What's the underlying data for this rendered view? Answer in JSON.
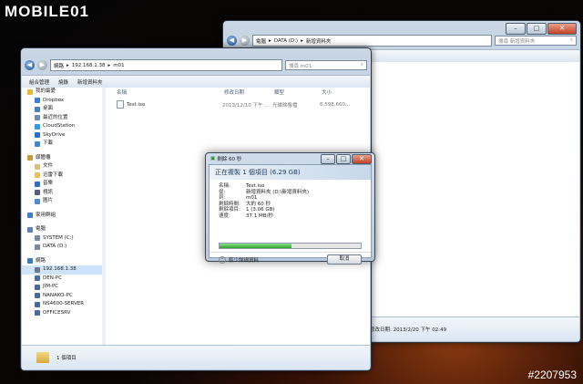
{
  "watermark": {
    "logo": "MOBILE01",
    "id": "#2207953"
  },
  "back_window": {
    "breadcrumb": [
      "電腦",
      "DATA (D:)",
      "新增資料夾"
    ],
    "search_placeholder": "搜尋 新增資料夾",
    "status_date": "修改日期: 2013/2/20 下午 02:49"
  },
  "front_window": {
    "breadcrumb": [
      "網路",
      "192.168.1.38",
      "m01"
    ],
    "search_placeholder": "搜尋 m01",
    "toolbar": [
      "組合管理",
      "燒錄",
      "新增資料夾"
    ],
    "nav_groups": [
      {
        "items": [
          {
            "label": "我的最愛",
            "icon": "star-icon",
            "color": "#e8b830"
          },
          {
            "label": "Dropbox",
            "icon": "dropbox-icon",
            "color": "#3b80d6"
          },
          {
            "label": "桌面",
            "icon": "desktop-icon",
            "color": "#4a7fc1"
          },
          {
            "label": "最近的位置",
            "icon": "recent-icon",
            "color": "#6b8db4"
          },
          {
            "label": "CloudStation",
            "icon": "cloud-icon",
            "color": "#2f9be0"
          },
          {
            "label": "SkyDrive",
            "icon": "skydrive-icon",
            "color": "#2a6fd1"
          },
          {
            "label": "下載",
            "icon": "download-icon",
            "color": "#3f86cf"
          }
        ]
      },
      {
        "items": [
          {
            "label": "媒體櫃",
            "icon": "library-icon",
            "color": "#c99a3a"
          },
          {
            "label": "文件",
            "icon": "documents-icon",
            "color": "#d9c07a"
          },
          {
            "label": "迅雷下載",
            "icon": "folder-icon",
            "color": "#e6c05a"
          },
          {
            "label": "音樂",
            "icon": "music-icon",
            "color": "#2f6fc4"
          },
          {
            "label": "視訊",
            "icon": "video-icon",
            "color": "#5a5a7a"
          },
          {
            "label": "圖片",
            "icon": "pictures-icon",
            "color": "#4b8bd0"
          }
        ]
      },
      {
        "items": [
          {
            "label": "家用群組",
            "icon": "homegroup-icon",
            "color": "#3a7fd0"
          }
        ]
      },
      {
        "items": [
          {
            "label": "電腦",
            "icon": "computer-icon",
            "color": "#5a84b5"
          },
          {
            "label": "SYSTEM (C:)",
            "icon": "drive-icon",
            "color": "#7a8a9a"
          },
          {
            "label": "DATA (D:)",
            "icon": "drive-icon",
            "color": "#7a8a9a"
          }
        ]
      },
      {
        "items": [
          {
            "label": "網路",
            "icon": "network-icon",
            "color": "#3a7ac8"
          },
          {
            "label": "192.168.1.38",
            "icon": "server-icon",
            "color": "#6a7a8a",
            "selected": true
          },
          {
            "label": "DEN-PC",
            "icon": "pc-icon",
            "color": "#4a6a9a"
          },
          {
            "label": "JIM-PC",
            "icon": "pc-icon",
            "color": "#4a6a9a"
          },
          {
            "label": "NANAKO-PC",
            "icon": "pc-icon",
            "color": "#4a6a9a"
          },
          {
            "label": "NS4600-SERVER",
            "icon": "pc-icon",
            "color": "#4a6a9a"
          },
          {
            "label": "OFFICESRV",
            "icon": "pc-icon",
            "color": "#4a6a9a"
          }
        ]
      }
    ],
    "columns": [
      "名稱",
      "修改日期",
      "類型",
      "大小"
    ],
    "files": [
      {
        "name": "Test.iso",
        "modified": "2013/12/10 下午 ...",
        "type": "光碟映像檔",
        "size": "6,598,660..."
      }
    ],
    "status_text": "1 個項目"
  },
  "dialog": {
    "title": "剩餘 60 秒",
    "heading": "正在複製 1 個項目 (6.29 GB)",
    "details": [
      {
        "k": "名稱:",
        "v": "Test.iso"
      },
      {
        "k": "從:",
        "v": "新增資料夾 (D:\\新增資料夾)"
      },
      {
        "k": "到:",
        "v": "m01"
      },
      {
        "k": "剩餘時間:",
        "v": "大約 60 秒"
      },
      {
        "k": "剩餘項目:",
        "v": "1 (3.06 GB)"
      },
      {
        "k": "速度:",
        "v": "37.1 MB/秒"
      }
    ],
    "progress": 0.51,
    "less_info": "較少詳細資料",
    "cancel": "取消"
  }
}
